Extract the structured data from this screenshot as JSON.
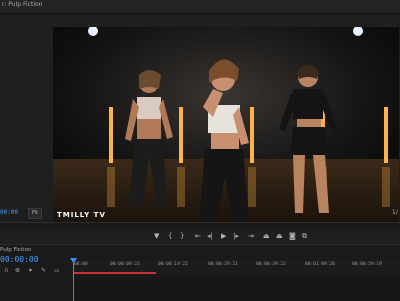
{
  "viewer": {
    "title": "r: Pulp Fiction",
    "watermark": "TMILLY TV",
    "current_timecode": "00:00",
    "fit_label": "Fit",
    "page_indicator": "1/"
  },
  "transport": {
    "buttons": [
      {
        "name": "add-marker-button",
        "icon": "marker-icon",
        "glyph": "▼"
      },
      {
        "name": "mark-in-button",
        "icon": "mark-in-icon",
        "glyph": "{"
      },
      {
        "name": "mark-out-button",
        "icon": "mark-out-icon",
        "glyph": "}"
      },
      {
        "name": "go-to-in-button",
        "icon": "go-to-in-icon",
        "glyph": "⇤"
      },
      {
        "name": "step-back-button",
        "icon": "step-back-icon",
        "glyph": "◂|"
      },
      {
        "name": "play-button",
        "icon": "play-icon",
        "glyph": "▶"
      },
      {
        "name": "step-forward-button",
        "icon": "step-forward-icon",
        "glyph": "|▸"
      },
      {
        "name": "go-to-out-button",
        "icon": "go-to-out-icon",
        "glyph": "⇥"
      },
      {
        "name": "lift-button",
        "icon": "lift-icon",
        "glyph": "⏏"
      },
      {
        "name": "extract-button",
        "icon": "extract-icon",
        "glyph": "⏏"
      },
      {
        "name": "export-frame-button",
        "icon": "camera-icon",
        "glyph": "◙"
      },
      {
        "name": "compare-view-button",
        "icon": "compare-icon",
        "glyph": "⧉"
      }
    ]
  },
  "timeline": {
    "sequence_tab": "Pulp Fiction",
    "timecode": "00:00:00",
    "ruler_ticks": [
      "00:00",
      "00:00:09:23",
      "00:00:19:22",
      "00:00:29:21",
      "00:00:39:22",
      "00:01:09:20",
      "00:00:59:19"
    ]
  },
  "colors": {
    "accent_blue": "#3d8bff",
    "work_area_red": "#c83232",
    "panel_bg": "#1d1d1d"
  }
}
